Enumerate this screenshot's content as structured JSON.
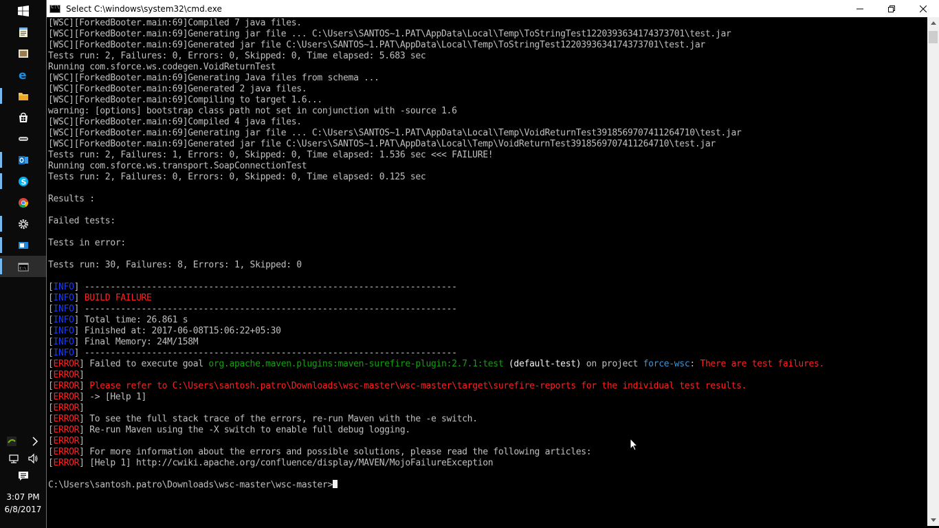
{
  "window": {
    "title": "Select C:\\windows\\system32\\cmd.exe"
  },
  "taskbar": {
    "icons": [
      "windows-start-icon",
      "notepad-icon",
      "app-icon",
      "edge-icon",
      "file-explorer-icon",
      "store-icon",
      "app-icon",
      "outlook-icon",
      "skype-icon",
      "chrome-icon",
      "settings-icon",
      "outlook-icon",
      "cmd-icon"
    ],
    "tray": {
      "time": "3:07 PM",
      "date": "6/8/2017"
    }
  },
  "console": {
    "lines": [
      [
        {
          "t": "[WSC][ForkedBooter.main:69]Compiled 7 java files."
        }
      ],
      [
        {
          "t": "[WSC][ForkedBooter.main:69]Generating jar file ... C:\\Users\\SANTOS~1.PAT\\AppData\\Local\\Temp\\ToStringTest1220393634174373701\\test.jar"
        }
      ],
      [
        {
          "t": "[WSC][ForkedBooter.main:69]Generated jar file C:\\Users\\SANTOS~1.PAT\\AppData\\Local\\Temp\\ToStringTest1220393634174373701\\test.jar"
        }
      ],
      [
        {
          "t": "Tests run: 2, Failures: 0, Errors: 0, Skipped: 0, Time elapsed: 5.683 sec"
        }
      ],
      [
        {
          "t": "Running com.sforce.ws.codegen.VoidReturnTest"
        }
      ],
      [
        {
          "t": "[WSC][ForkedBooter.main:69]Generating Java files from schema ..."
        }
      ],
      [
        {
          "t": "[WSC][ForkedBooter.main:69]Generated 2 java files."
        }
      ],
      [
        {
          "t": "[WSC][ForkedBooter.main:69]Compiling to target 1.6..."
        }
      ],
      [
        {
          "t": "warning: [options] bootstrap class path not set in conjunction with -source 1.6"
        }
      ],
      [
        {
          "t": "[WSC][ForkedBooter.main:69]Compiled 4 java files."
        }
      ],
      [
        {
          "t": "[WSC][ForkedBooter.main:69]Generating jar file ... C:\\Users\\SANTOS~1.PAT\\AppData\\Local\\Temp\\VoidReturnTest3918569707411264710\\test.jar"
        }
      ],
      [
        {
          "t": "[WSC][ForkedBooter.main:69]Generated jar file C:\\Users\\SANTOS~1.PAT\\AppData\\Local\\Temp\\VoidReturnTest3918569707411264710\\test.jar"
        }
      ],
      [
        {
          "t": "Tests run: 2, Failures: 1, Errors: 0, Skipped: 0, Time elapsed: 1.536 sec <<< FAILURE!"
        }
      ],
      [
        {
          "t": "Running com.sforce.ws.transport.SoapConnectionTest"
        }
      ],
      [
        {
          "t": "Tests run: 2, Failures: 0, Errors: 0, Skipped: 0, Time elapsed: 0.125 sec"
        }
      ],
      [
        {
          "t": ""
        }
      ],
      [
        {
          "t": "Results :"
        }
      ],
      [
        {
          "t": ""
        }
      ],
      [
        {
          "t": "Failed tests:"
        }
      ],
      [
        {
          "t": ""
        }
      ],
      [
        {
          "t": "Tests in error:"
        }
      ],
      [
        {
          "t": ""
        }
      ],
      [
        {
          "t": "Tests run: 30, Failures: 8, Errors: 1, Skipped: 0"
        }
      ],
      [
        {
          "t": ""
        }
      ],
      [
        {
          "t": "["
        },
        {
          "t": "INFO",
          "c": "blue"
        },
        {
          "t": "] ------------------------------------------------------------------------"
        }
      ],
      [
        {
          "t": "["
        },
        {
          "t": "INFO",
          "c": "blue"
        },
        {
          "t": "] "
        },
        {
          "t": "BUILD FAILURE",
          "c": "red"
        }
      ],
      [
        {
          "t": "["
        },
        {
          "t": "INFO",
          "c": "blue"
        },
        {
          "t": "] ------------------------------------------------------------------------"
        }
      ],
      [
        {
          "t": "["
        },
        {
          "t": "INFO",
          "c": "blue"
        },
        {
          "t": "] Total time: 26.861 s"
        }
      ],
      [
        {
          "t": "["
        },
        {
          "t": "INFO",
          "c": "blue"
        },
        {
          "t": "] Finished at: 2017-06-08T15:06:22+05:30"
        }
      ],
      [
        {
          "t": "["
        },
        {
          "t": "INFO",
          "c": "blue"
        },
        {
          "t": "] Final Memory: 24M/158M"
        }
      ],
      [
        {
          "t": "["
        },
        {
          "t": "INFO",
          "c": "blue"
        },
        {
          "t": "] ------------------------------------------------------------------------"
        }
      ],
      [
        {
          "t": "["
        },
        {
          "t": "ERROR",
          "c": "red"
        },
        {
          "t": "] Failed to execute goal "
        },
        {
          "t": "org.apache.maven.plugins:maven-surefire-plugin:2.7.1:test",
          "c": "green"
        },
        {
          "t": " (default-test)",
          "c": "white"
        },
        {
          "t": " on project "
        },
        {
          "t": "force-wsc",
          "c": "cyan"
        },
        {
          "t": ": "
        },
        {
          "t": "There are test failures.",
          "c": "red"
        }
      ],
      [
        {
          "t": "["
        },
        {
          "t": "ERROR",
          "c": "red"
        },
        {
          "t": "]"
        }
      ],
      [
        {
          "t": "["
        },
        {
          "t": "ERROR",
          "c": "red"
        },
        {
          "t": "] "
        },
        {
          "t": "Please refer to C:\\Users\\santosh.patro\\Downloads\\wsc-master\\wsc-master\\target\\surefire-reports for the individual test results.",
          "c": "red"
        }
      ],
      [
        {
          "t": "["
        },
        {
          "t": "ERROR",
          "c": "red"
        },
        {
          "t": "] -> [Help 1]"
        }
      ],
      [
        {
          "t": "["
        },
        {
          "t": "ERROR",
          "c": "red"
        },
        {
          "t": "]"
        }
      ],
      [
        {
          "t": "["
        },
        {
          "t": "ERROR",
          "c": "red"
        },
        {
          "t": "] To see the full stack trace of the errors, re-run Maven with the -e switch."
        }
      ],
      [
        {
          "t": "["
        },
        {
          "t": "ERROR",
          "c": "red"
        },
        {
          "t": "] Re-run Maven using the -X switch to enable full debug logging."
        }
      ],
      [
        {
          "t": "["
        },
        {
          "t": "ERROR",
          "c": "red"
        },
        {
          "t": "]"
        }
      ],
      [
        {
          "t": "["
        },
        {
          "t": "ERROR",
          "c": "red"
        },
        {
          "t": "] For more information about the errors and possible solutions, please read the following articles:"
        }
      ],
      [
        {
          "t": "["
        },
        {
          "t": "ERROR",
          "c": "red"
        },
        {
          "t": "] [Help 1] http://cwiki.apache.org/confluence/display/MAVEN/MojoFailureException"
        }
      ],
      [
        {
          "t": ""
        }
      ],
      [
        {
          "t": "C:\\Users\\santosh.patro\\Downloads\\wsc-master\\wsc-master>"
        },
        {
          "t": "",
          "cursor": true
        }
      ]
    ]
  },
  "colors": {
    "background": "#000000",
    "text": "#c0c0c0",
    "info": "#1c3cff",
    "error": "#ff2020",
    "plugin": "#13a10e",
    "project": "#3a96dd"
  }
}
